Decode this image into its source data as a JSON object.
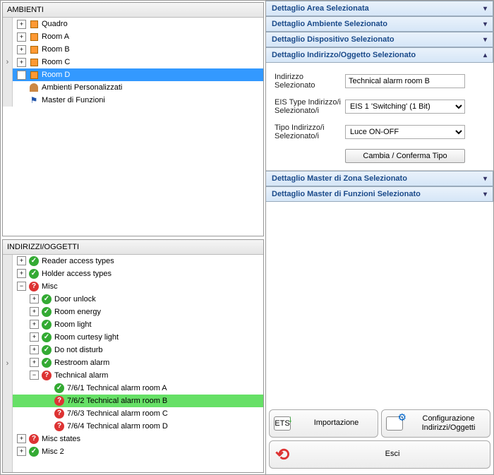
{
  "ambienti": {
    "title": "AMBIENTI",
    "items": [
      {
        "label": "Quadro",
        "toggle": "+",
        "icon": "box"
      },
      {
        "label": "Room A",
        "toggle": "+",
        "icon": "box"
      },
      {
        "label": "Room B",
        "toggle": "+",
        "icon": "box"
      },
      {
        "label": "Room C",
        "toggle": "+",
        "icon": "box"
      },
      {
        "label": "Room D",
        "toggle": "+",
        "icon": "box",
        "selected": true
      },
      {
        "label": "Ambienti Personalizzati",
        "toggle": "",
        "icon": "person"
      },
      {
        "label": "Master di Funzioni",
        "toggle": "",
        "icon": "mf"
      }
    ]
  },
  "indirizzi": {
    "title": "INDIRIZZI/OGGETTI",
    "nodes": [
      {
        "d": 0,
        "t": "+",
        "s": "ok",
        "label": "Reader access types"
      },
      {
        "d": 0,
        "t": "+",
        "s": "ok",
        "label": "Holder access types"
      },
      {
        "d": 0,
        "t": "−",
        "s": "q",
        "label": "Misc"
      },
      {
        "d": 1,
        "t": "+",
        "s": "ok",
        "label": "Door unlock"
      },
      {
        "d": 1,
        "t": "+",
        "s": "ok",
        "label": "Room energy"
      },
      {
        "d": 1,
        "t": "+",
        "s": "ok",
        "label": "Room light"
      },
      {
        "d": 1,
        "t": "+",
        "s": "ok",
        "label": "Room curtesy light"
      },
      {
        "d": 1,
        "t": "+",
        "s": "ok",
        "label": "Do not disturb"
      },
      {
        "d": 1,
        "t": "+",
        "s": "ok",
        "label": "Restroom alarm"
      },
      {
        "d": 1,
        "t": "−",
        "s": "q",
        "label": "Technical alarm"
      },
      {
        "d": 2,
        "t": "",
        "s": "ok",
        "label": "7/6/1 Technical alarm room A"
      },
      {
        "d": 2,
        "t": "",
        "s": "q",
        "label": "7/6/2 Technical alarm room B",
        "sel": true
      },
      {
        "d": 2,
        "t": "",
        "s": "q",
        "label": "7/6/3 Technical alarm room C"
      },
      {
        "d": 2,
        "t": "",
        "s": "q",
        "label": "7/6/4 Technical alarm room D"
      },
      {
        "d": 0,
        "t": "+",
        "s": "q",
        "label": "Misc states"
      },
      {
        "d": 0,
        "t": "+",
        "s": "ok",
        "label": "Misc 2"
      }
    ]
  },
  "accordion": {
    "area": "Dettaglio Area Selezionata",
    "ambiente": "Dettaglio Ambiente Selezionato",
    "dispositivo": "Dettaglio Dispositivo Selezionato",
    "indirizzo": "Dettaglio Indirizzo/Oggetto Selezionato",
    "zona": "Dettaglio Master di Zona Selezionato",
    "funzioni": "Dettaglio Master di Funzioni Selezionato"
  },
  "detail": {
    "indirizzo_label": "Indirizzo Selezionato",
    "indirizzo_value": "Technical alarm room B",
    "eis_label": "EIS Type Indirizzo/i Selezionato/i",
    "eis_value": "EIS 1 'Switching' (1 Bit)",
    "tipo_label": "Tipo Indirizzo/i Selezionato/i",
    "tipo_value": "Luce ON-OFF",
    "confirm": "Cambia / Conferma Tipo"
  },
  "buttons": {
    "import": "Importazione",
    "config_l1": "Configurazione",
    "config_l2": "Indirizzi/Oggetti",
    "exit": "Esci",
    "ets": "ETS"
  }
}
